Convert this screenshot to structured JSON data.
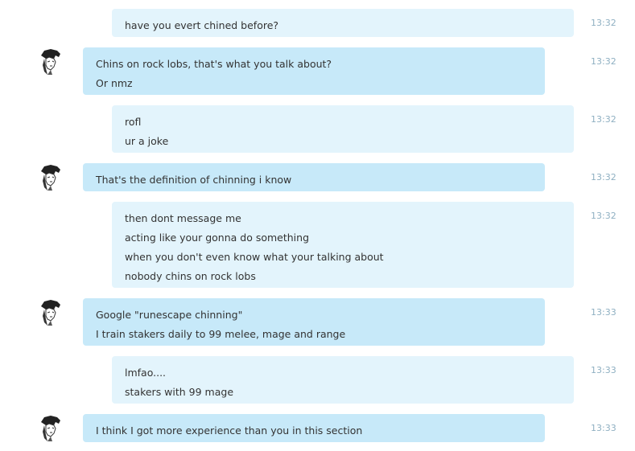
{
  "messages": [
    {
      "dir": "out",
      "time": "13:32",
      "lines": [
        "have you evert chined before?"
      ]
    },
    {
      "dir": "in",
      "time": "13:32",
      "lines": [
        "Chins on rock lobs, that's what you talk about?",
        "Or nmz"
      ]
    },
    {
      "dir": "out",
      "time": "13:32",
      "lines": [
        "rofl",
        "ur a joke"
      ]
    },
    {
      "dir": "in",
      "time": "13:32",
      "lines": [
        "That's the definition of chinning i know"
      ]
    },
    {
      "dir": "out",
      "time": "13:32",
      "lines": [
        "then dont message me",
        "acting like your gonna do something",
        "when you don't even know what your talking about",
        "nobody chins on rock lobs"
      ]
    },
    {
      "dir": "in",
      "time": "13:33",
      "lines": [
        "Google \"runescape chinning\"",
        "I train stakers daily to 99 melee, mage and range"
      ]
    },
    {
      "dir": "out",
      "time": "13:33",
      "lines": [
        "lmfao....",
        "stakers with 99 mage"
      ]
    },
    {
      "dir": "in",
      "time": "13:33",
      "lines": [
        "I think I got more experience than you in this section"
      ]
    }
  ],
  "colors": {
    "incoming_bubble": "#c7e9f9",
    "outgoing_bubble": "#e3f4fc",
    "timestamp": "#8fb0c2",
    "text": "#333333"
  },
  "icons": {
    "contact_avatar": "sketch-portrait-avatar-icon"
  }
}
